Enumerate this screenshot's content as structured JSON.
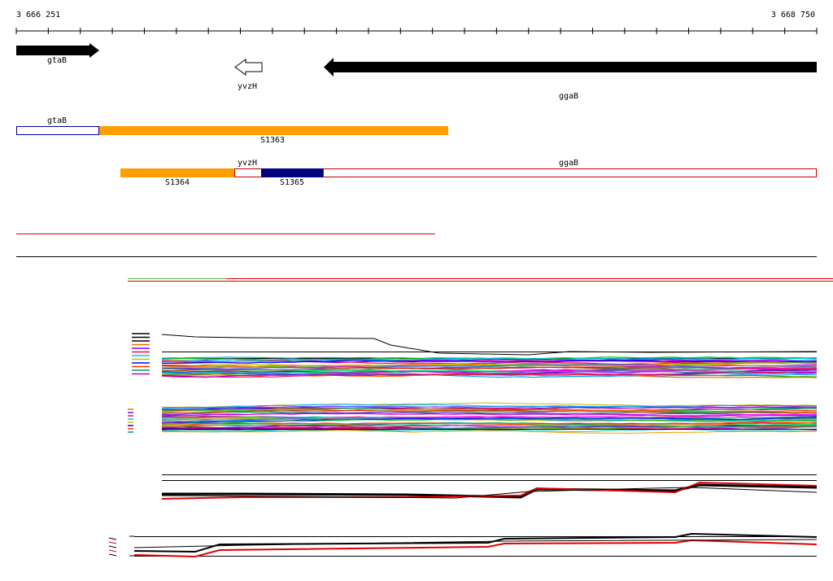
{
  "ruler": {
    "start_label": "3 666 251",
    "end_label": "3 668 750"
  },
  "genes": {
    "gtaB": "gtaB",
    "yvzH": "yvzH",
    "ggaB": "ggaB"
  },
  "segments": {
    "s1363": "S1363",
    "s1364": "S1364",
    "s1365": "S1365"
  },
  "colors": {
    "gene_arrow": "#000000",
    "segment_orange": "#ff9e00",
    "segment_navy": "#000080",
    "outline_blue": "#0000a0",
    "outline_red": "#c00000",
    "coverage_red": "#e00000",
    "coverage_green": "#44c044"
  }
}
